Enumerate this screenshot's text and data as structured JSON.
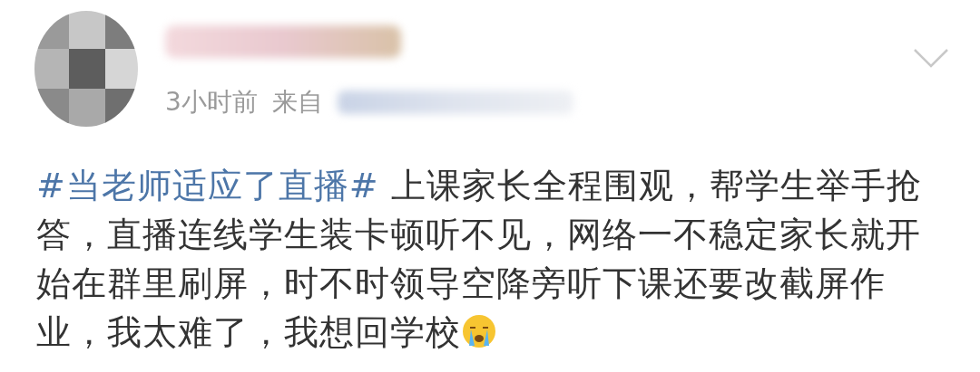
{
  "post": {
    "time": "3小时前",
    "source_label": "来自",
    "hashtag": "#当老师适应了直播#",
    "body": " 上课家长全程围观，帮学生举手抢答，直播连线学生装卡顿听不见，网络一不稳定家长就开始在群里刷屏，时不时领导空降旁听下课还要改截屏作业，我太难了，我想回学校"
  }
}
